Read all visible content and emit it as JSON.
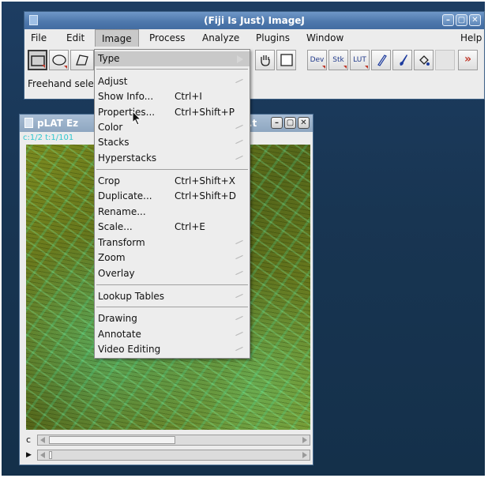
{
  "main_window": {
    "title": "(Fiji Is Just) ImageJ",
    "menus": [
      "File",
      "Edit",
      "Image",
      "Process",
      "Analyze",
      "Plugins",
      "Window",
      "Help"
    ],
    "window_buttons": [
      "minimize-icon",
      "maximize-icon",
      "close-icon"
    ],
    "toolbar": {
      "tools": [
        "rectangle-icon",
        "oval-icon",
        "polygon-icon",
        "hand-icon",
        "color-picker-icon",
        "Dev",
        "Stk",
        "LUT",
        "pencil-icon",
        "brush-icon",
        "flood-fill-icon",
        "more-tools-icon"
      ],
      "labels": {
        "dev": "Dev",
        "stk": "Stk",
        "lut": "LUT",
        "more": "»"
      }
    },
    "status_text": "Freehand sele"
  },
  "image_window": {
    "title_left": "pLAT Ez",
    "title_right": ".t",
    "info_line": "c:1/2 t:1/101",
    "channel_label": "c",
    "time_label": "▶"
  },
  "image_menu": {
    "items": [
      {
        "label": "Type",
        "shortcut": "",
        "submenu": true,
        "highlighted": true
      },
      {
        "label": "Adjust",
        "shortcut": "",
        "submenu": true
      },
      {
        "label": "Show Info...",
        "shortcut": "Ctrl+I",
        "submenu": false
      },
      {
        "label": "Properties...",
        "shortcut": "Ctrl+Shift+P",
        "submenu": false
      },
      {
        "label": "Color",
        "shortcut": "",
        "submenu": true
      },
      {
        "label": "Stacks",
        "shortcut": "",
        "submenu": true
      },
      {
        "label": "Hyperstacks",
        "shortcut": "",
        "submenu": true
      },
      {
        "label": "Crop",
        "shortcut": "Ctrl+Shift+X",
        "submenu": false
      },
      {
        "label": "Duplicate...",
        "shortcut": "Ctrl+Shift+D",
        "submenu": false
      },
      {
        "label": "Rename...",
        "shortcut": "",
        "submenu": false
      },
      {
        "label": "Scale...",
        "shortcut": "Ctrl+E",
        "submenu": false
      },
      {
        "label": "Transform",
        "shortcut": "",
        "submenu": true
      },
      {
        "label": "Zoom",
        "shortcut": "",
        "submenu": true
      },
      {
        "label": "Overlay",
        "shortcut": "",
        "submenu": true
      },
      {
        "label": "Lookup Tables",
        "shortcut": "",
        "submenu": true
      },
      {
        "label": "Drawing",
        "shortcut": "",
        "submenu": true
      },
      {
        "label": "Annotate",
        "shortcut": "",
        "submenu": true
      },
      {
        "label": "Video Editing",
        "shortcut": "",
        "submenu": true
      }
    ]
  },
  "colors": {
    "desktop": "#183552",
    "titlebar_active": "#4f79ad",
    "menu_background": "#ededed",
    "menu_highlight": "#c9c9c9",
    "image_info_text": "#2fc7cf"
  }
}
